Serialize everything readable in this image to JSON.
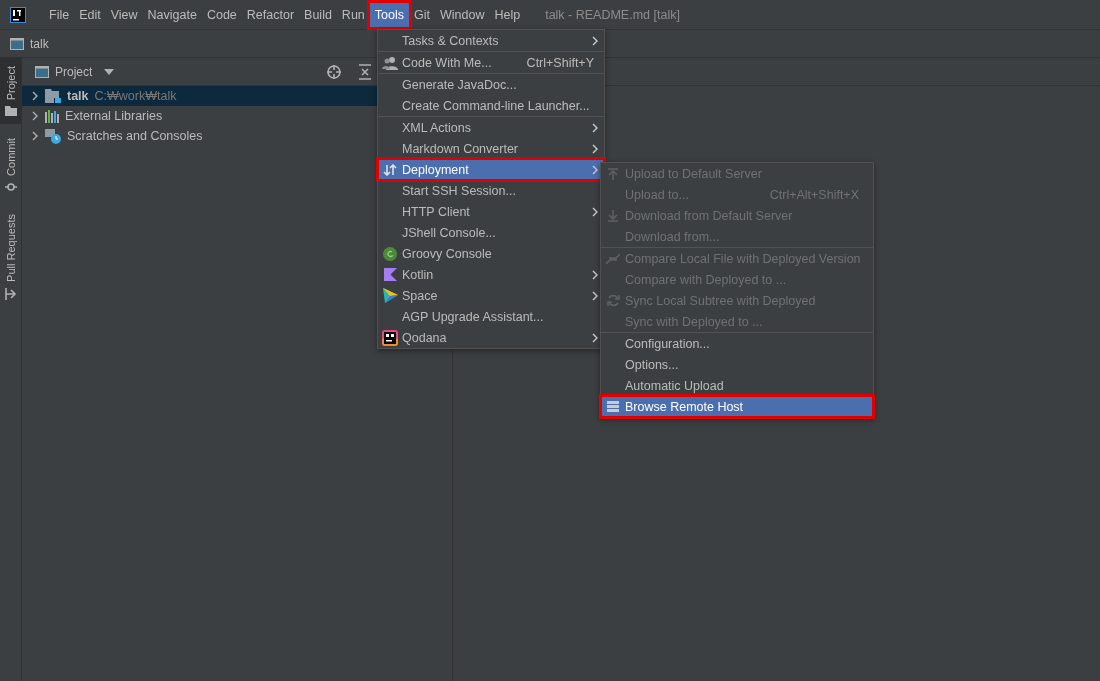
{
  "menubar": {
    "items": [
      {
        "label": "File",
        "selected": false,
        "marked": false
      },
      {
        "label": "Edit",
        "selected": false,
        "marked": false
      },
      {
        "label": "View",
        "selected": false,
        "marked": false
      },
      {
        "label": "Navigate",
        "selected": false,
        "marked": false
      },
      {
        "label": "Code",
        "selected": false,
        "marked": false
      },
      {
        "label": "Refactor",
        "selected": false,
        "marked": false
      },
      {
        "label": "Build",
        "selected": false,
        "marked": false
      },
      {
        "label": "Run",
        "selected": false,
        "marked": false
      },
      {
        "label": "Tools",
        "selected": true,
        "marked": true
      },
      {
        "label": "Git",
        "selected": false,
        "marked": false
      },
      {
        "label": "Window",
        "selected": false,
        "marked": false
      },
      {
        "label": "Help",
        "selected": false,
        "marked": false
      }
    ],
    "title": "talk - README.md [talk]"
  },
  "navbar": {
    "crumb": "talk"
  },
  "side_tabs": [
    {
      "label": "Project",
      "kind": "folder",
      "selected": true
    },
    {
      "label": "Commit",
      "kind": "commit",
      "selected": false
    },
    {
      "label": "Pull Requests",
      "kind": "pull",
      "selected": false
    }
  ],
  "project_panel": {
    "title": "Project",
    "tree": [
      {
        "name": "talk",
        "path": "C:₩work₩talk",
        "kind": "module",
        "selected": true,
        "expanded": false
      },
      {
        "name": "External Libraries",
        "kind": "libraries",
        "selected": false,
        "expanded": false
      },
      {
        "name": "Scratches and Consoles",
        "kind": "scratches",
        "selected": false,
        "expanded": false
      }
    ]
  },
  "tools_menu": {
    "groups": [
      [
        {
          "label": "Tasks & Contexts",
          "submenu": true,
          "selected": false,
          "marked": false
        }
      ],
      [
        {
          "label": "Code With Me...",
          "kind": "people",
          "shortcut": "Ctrl+Shift+Y",
          "submenu": false,
          "selected": false,
          "marked": false
        }
      ],
      [
        {
          "label": "Generate JavaDoc...",
          "submenu": false,
          "selected": false,
          "marked": false
        },
        {
          "label": "Create Command-line Launcher...",
          "submenu": false,
          "selected": false,
          "marked": false
        }
      ],
      [
        {
          "label": "XML Actions",
          "submenu": true,
          "selected": false,
          "marked": false
        },
        {
          "label": "Markdown Converter",
          "submenu": true,
          "selected": false,
          "marked": false
        },
        {
          "label": "Deployment",
          "kind": "updown",
          "submenu": true,
          "selected": true,
          "marked": true
        },
        {
          "label": "Start SSH Session...",
          "submenu": false,
          "selected": false,
          "marked": false
        },
        {
          "label": "HTTP Client",
          "submenu": true,
          "selected": false,
          "marked": false
        },
        {
          "label": "JShell Console...",
          "submenu": false,
          "selected": false,
          "marked": false
        },
        {
          "label": "Groovy Console",
          "kind": "groovy",
          "submenu": false,
          "selected": false,
          "marked": false
        },
        {
          "label": "Kotlin",
          "kind": "kotlin",
          "submenu": true,
          "selected": false,
          "marked": false
        },
        {
          "label": "Space",
          "kind": "space",
          "submenu": true,
          "selected": false,
          "marked": false
        },
        {
          "label": "AGP Upgrade Assistant...",
          "submenu": false,
          "selected": false,
          "marked": false
        },
        {
          "label": "Qodana",
          "kind": "qodana",
          "submenu": true,
          "selected": false,
          "marked": false
        }
      ]
    ]
  },
  "deployment_menu": {
    "groups": [
      [
        {
          "label": "Upload to Default Server",
          "kind": "upload",
          "disabled": true,
          "selected": false,
          "marked": false
        },
        {
          "label": "Upload to...",
          "shortcut": "Ctrl+Alt+Shift+X",
          "disabled": true,
          "selected": false,
          "marked": false
        },
        {
          "label": "Download from Default Server",
          "kind": "download",
          "disabled": true,
          "selected": false,
          "marked": false
        },
        {
          "label": "Download from...",
          "disabled": true,
          "selected": false,
          "marked": false
        }
      ],
      [
        {
          "label": "Compare Local File with Deployed Version",
          "kind": "compare",
          "disabled": true,
          "selected": false,
          "marked": false
        },
        {
          "label": "Compare with Deployed to ...",
          "disabled": true,
          "selected": false,
          "marked": false
        },
        {
          "label": "Sync Local Subtree with Deployed",
          "kind": "sync",
          "disabled": true,
          "selected": false,
          "marked": false
        },
        {
          "label": "Sync with Deployed to ...",
          "disabled": true,
          "selected": false,
          "marked": false
        }
      ],
      [
        {
          "label": "Configuration...",
          "disabled": false,
          "selected": false,
          "marked": false
        },
        {
          "label": "Options...",
          "disabled": false,
          "selected": false,
          "marked": false
        },
        {
          "label": "Automatic Upload",
          "disabled": false,
          "selected": false,
          "marked": false
        },
        {
          "label": "Browse Remote Host",
          "kind": "list",
          "disabled": false,
          "selected": true,
          "marked": true
        }
      ]
    ]
  }
}
